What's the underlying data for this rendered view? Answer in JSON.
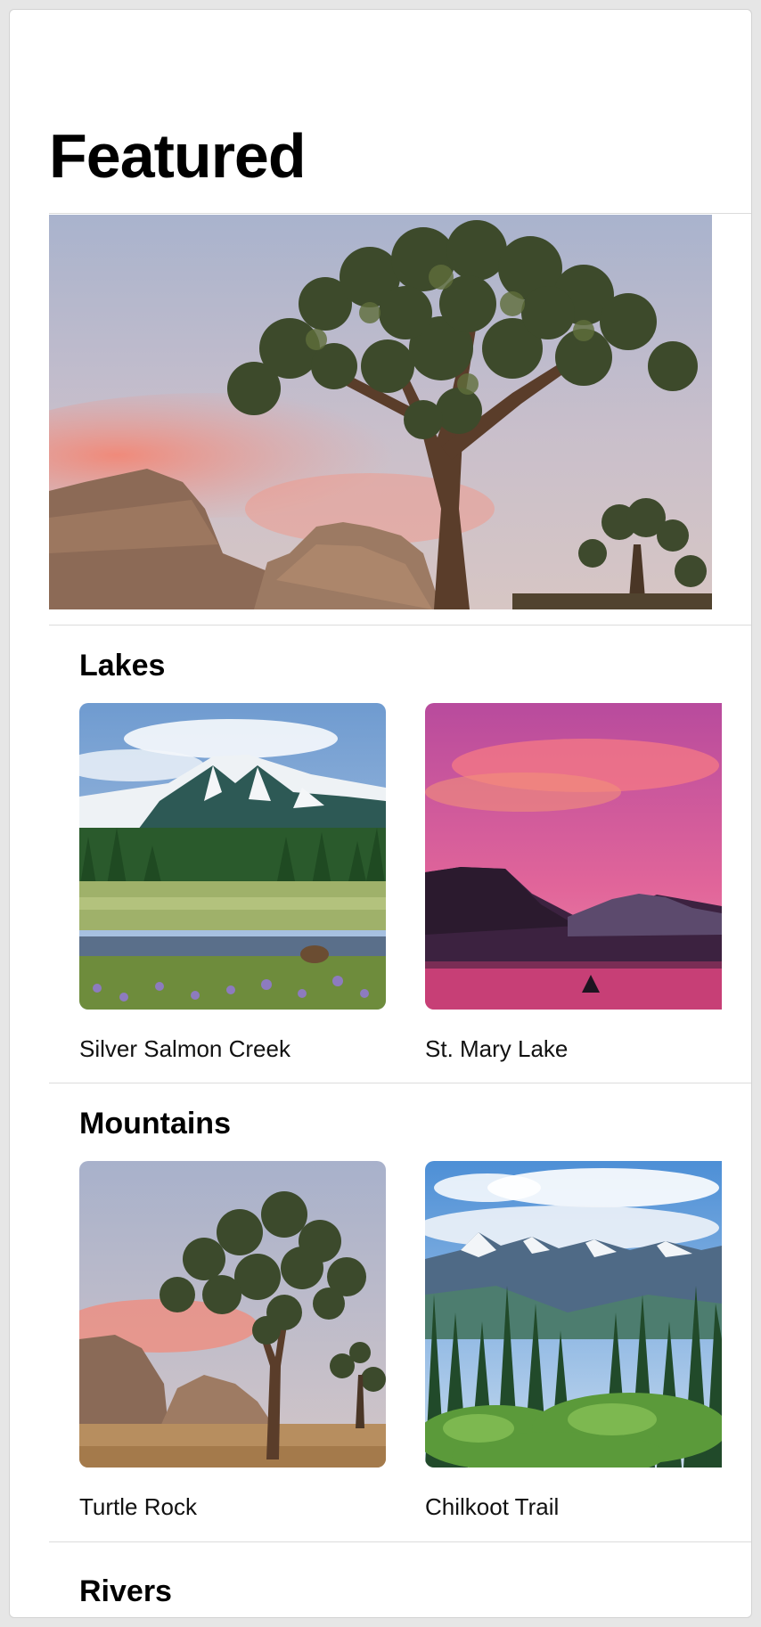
{
  "header": {
    "title": "Featured"
  },
  "featured": {
    "image": "joshua-tree-featured-photo"
  },
  "sections": [
    {
      "title": "Lakes",
      "items": [
        {
          "name": "Silver Salmon Creek",
          "image": "silver-salmon-creek-photo"
        },
        {
          "name": "St. Mary Lake",
          "image": "st-mary-lake-photo"
        }
      ]
    },
    {
      "title": "Mountains",
      "items": [
        {
          "name": "Turtle Rock",
          "image": "turtle-rock-photo"
        },
        {
          "name": "Chilkoot Trail",
          "image": "chilkoot-trail-photo"
        }
      ]
    },
    {
      "title": "Rivers",
      "items": []
    }
  ]
}
